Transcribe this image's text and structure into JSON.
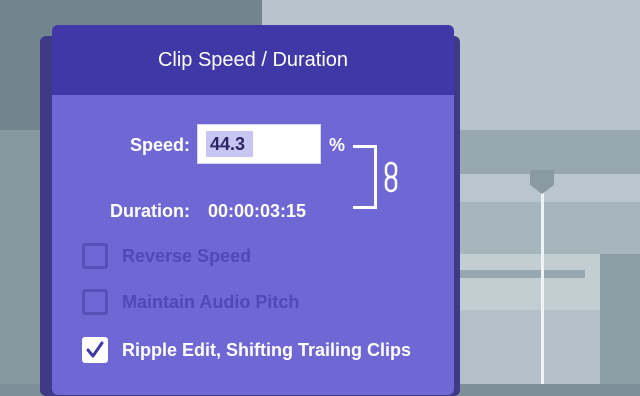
{
  "dialog": {
    "title": "Clip Speed / Duration",
    "speed_label": "Speed:",
    "speed_value": "44.3",
    "percent_sign": "%",
    "duration_label": "Duration:",
    "duration_value": "00:00:03:15",
    "checkboxes": [
      {
        "label": "Reverse Speed",
        "checked": false,
        "enabled": false
      },
      {
        "label": "Maintain Audio Pitch",
        "checked": false,
        "enabled": false
      },
      {
        "label": "Ripple Edit, Shifting Trailing Clips",
        "checked": true,
        "enabled": true
      }
    ],
    "link_icon": "chain-link-icon"
  },
  "colors": {
    "dialog_body": "#6f67d3",
    "dialog_header": "#4038a6",
    "input_highlight": "#c9c5f2",
    "disabled_text": "#5148b9"
  }
}
